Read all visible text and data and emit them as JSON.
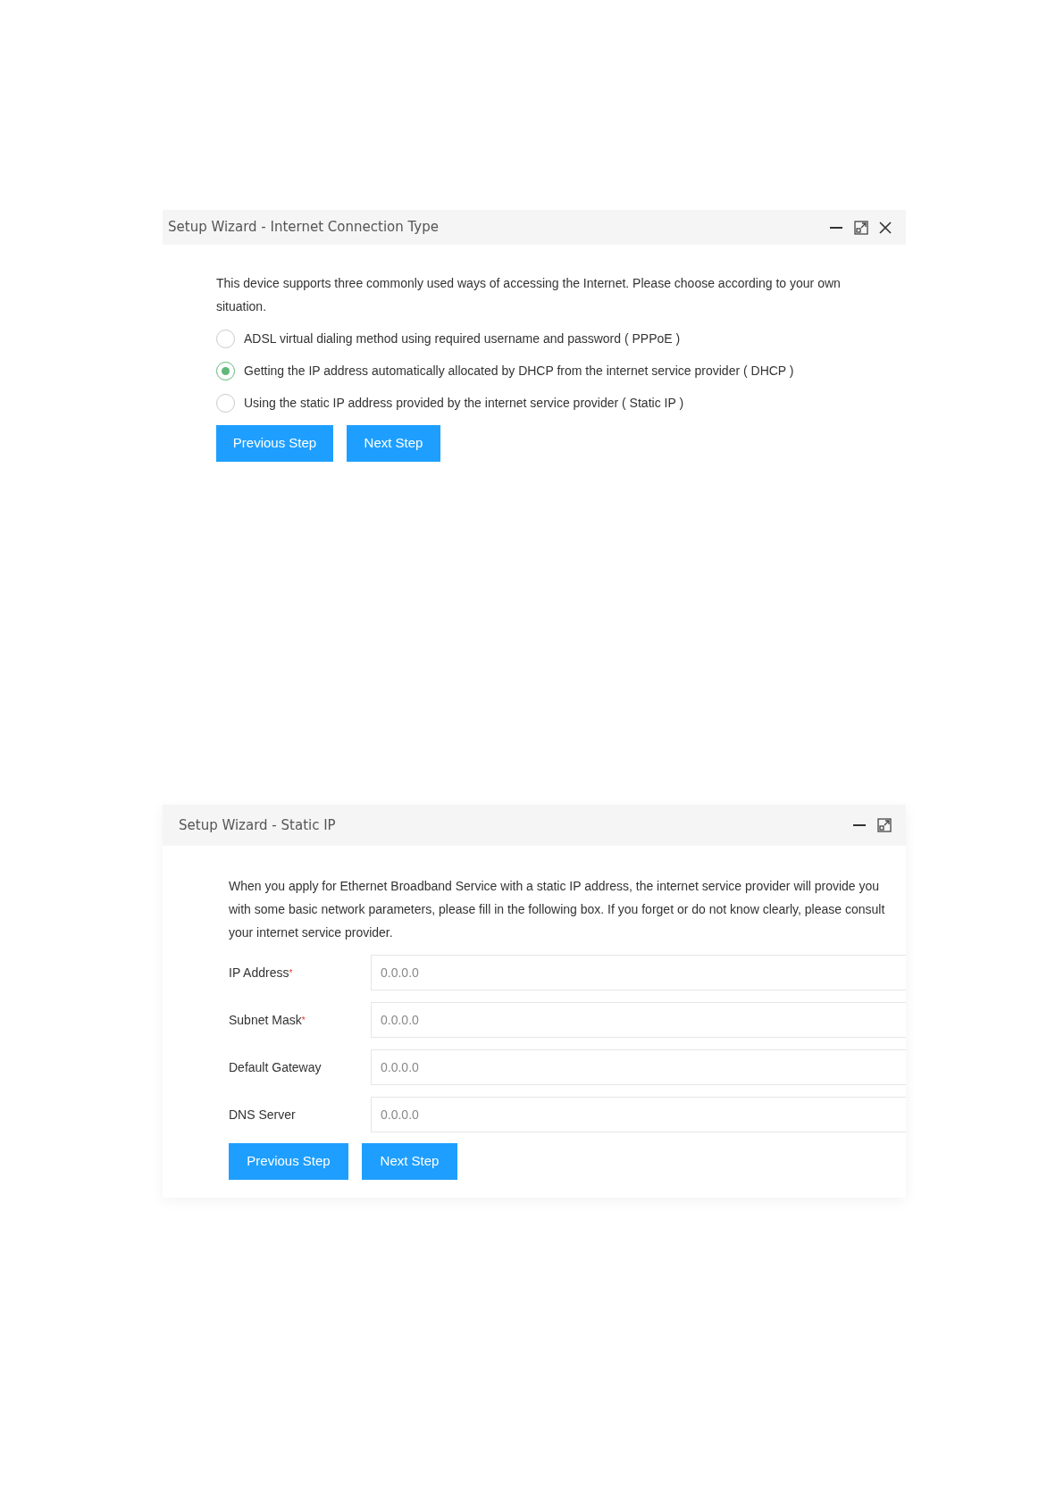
{
  "connection_type_window": {
    "title": "Setup Wizard - Internet Connection Type",
    "window_controls": [
      {
        "kind": "minimize"
      },
      {
        "kind": "maximize"
      },
      {
        "kind": "close"
      }
    ],
    "intro": "This device supports three commonly used ways of accessing the Internet. Please choose according to your own situation.",
    "options": [
      {
        "label": "ADSL virtual dialing method using required username and password ( PPPoE )",
        "selected": false
      },
      {
        "label": "Getting the IP address automatically allocated by DHCP from the internet service provider ( DHCP )",
        "selected": true
      },
      {
        "label": "Using the static IP address provided by the internet service provider ( Static IP )",
        "selected": false
      }
    ],
    "buttons": [
      "Previous Step",
      "Next Step"
    ]
  },
  "static_ip_window": {
    "title": "Setup Wizard - Static IP",
    "window_controls": [
      {
        "kind": "minimize"
      },
      {
        "kind": "maximize"
      }
    ],
    "intro": "When you apply for Ethernet Broadband Service with a static IP address, the internet service provider will provide you with some basic network parameters, please fill in the following box. If you forget or do not know clearly, please consult your internet service provider.",
    "fields": [
      {
        "label": "IP Address",
        "required_mark": "*",
        "placeholder": "0.0.0.0"
      },
      {
        "label": "Subnet Mask",
        "required_mark": "*",
        "placeholder": "0.0.0.0"
      },
      {
        "label": "Default Gateway",
        "placeholder": "0.0.0.0"
      },
      {
        "label": "DNS Server",
        "placeholder": "0.0.0.0"
      }
    ],
    "buttons": [
      "Previous Step",
      "Next Step"
    ]
  }
}
